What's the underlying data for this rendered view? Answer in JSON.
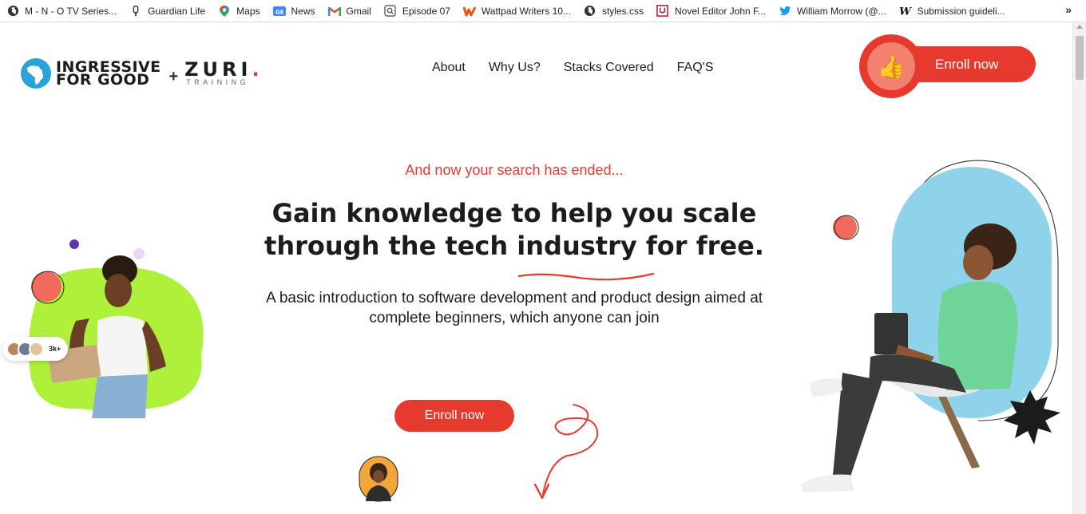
{
  "bookmarks": [
    {
      "label": "M - N - O TV Series...",
      "icon": "globe-icon"
    },
    {
      "label": "Guardian Life",
      "icon": "guardian-icon"
    },
    {
      "label": "Maps",
      "icon": "maps-icon"
    },
    {
      "label": "News",
      "icon": "news-icon"
    },
    {
      "label": "Gmail",
      "icon": "gmail-icon"
    },
    {
      "label": "Episode 07",
      "icon": "search-page-icon"
    },
    {
      "label": "Wattpad Writers 10...",
      "icon": "wattpad-icon"
    },
    {
      "label": "styles.css",
      "icon": "globe-icon"
    },
    {
      "label": "Novel Editor John F...",
      "icon": "editor-icon"
    },
    {
      "label": "William Morrow (@...",
      "icon": "twitter-icon"
    },
    {
      "label": "Submission guideli...",
      "icon": "w-icon"
    }
  ],
  "bookmarks_more": "»",
  "logo": {
    "ingressive_line1": "INGRESSIVE",
    "ingressive_line2": "FOR GOOD",
    "plus": "+",
    "zuri": "ZURI",
    "zuri_dot": ".",
    "zuri_sub": "TRAINING"
  },
  "nav": {
    "about": "About",
    "why_us": "Why Us?",
    "stacks": "Stacks Covered",
    "faq": "FAQ'S"
  },
  "header_enroll": "Enroll now",
  "thumb_emoji": "👍",
  "hero": {
    "tagline": "And now your search has ended...",
    "headline_line1": "Gain knowledge to help you scale",
    "headline_line2": "through the tech industry for free.",
    "subtext_line1": "A basic introduction to software development and product design aimed at",
    "subtext_line2": "complete beginners, which anyone can join",
    "enroll": "Enroll now"
  },
  "avatars_count": "3k+",
  "colors": {
    "accent": "#e63a2f",
    "lime": "#aef03a",
    "sky": "#8fd3ea",
    "purple": "#5b33b5"
  }
}
